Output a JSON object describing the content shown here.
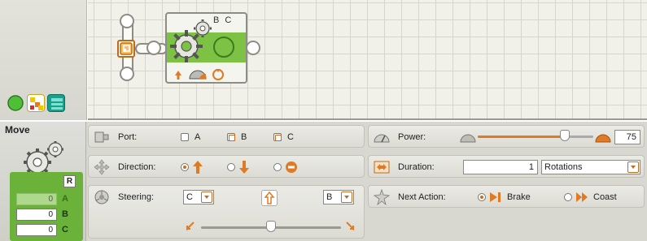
{
  "canvas": {
    "block": {
      "ports_label": "B C"
    }
  },
  "config": {
    "block_title": "Move",
    "readout": {
      "reset_label": "R",
      "rows": [
        {
          "value": "0",
          "letter": "A",
          "active": false
        },
        {
          "value": "0",
          "letter": "B",
          "active": true
        },
        {
          "value": "0",
          "letter": "C",
          "active": true
        }
      ]
    },
    "port": {
      "label": "Port:",
      "options": [
        {
          "label": "A",
          "checked": false
        },
        {
          "label": "B",
          "checked": true
        },
        {
          "label": "C",
          "checked": true
        }
      ]
    },
    "direction": {
      "label": "Direction:",
      "options": [
        {
          "icon": "up-arrow-icon",
          "selected": true
        },
        {
          "icon": "down-arrow-icon",
          "selected": false
        },
        {
          "icon": "stop-icon",
          "selected": false
        }
      ]
    },
    "steering": {
      "label": "Steering:",
      "left_port": "C",
      "right_port": "B",
      "level": 0.5
    },
    "power": {
      "label": "Power:",
      "value": "75",
      "level": 0.75
    },
    "duration": {
      "label": "Duration:",
      "value": "1",
      "unit": "Rotations"
    },
    "next_action": {
      "label": "Next Action:",
      "brake_label": "Brake",
      "coast_label": "Coast",
      "selected": "Brake"
    }
  },
  "colors": {
    "accent_orange": "#e07a24",
    "block_green": "#7dc244",
    "readout_green": "#6ab23a"
  }
}
